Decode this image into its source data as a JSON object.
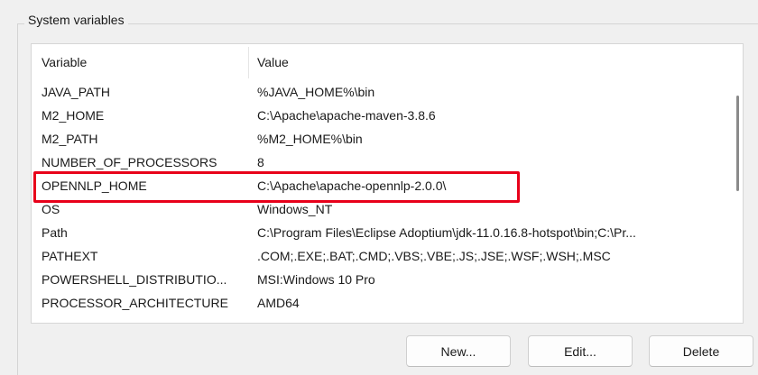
{
  "group": {
    "title": "System variables"
  },
  "list": {
    "columns": {
      "variable": "Variable",
      "value": "Value"
    },
    "rows": [
      {
        "variable": "JAVA_PATH",
        "value": "%JAVA_HOME%\\bin"
      },
      {
        "variable": "M2_HOME",
        "value": "C:\\Apache\\apache-maven-3.8.6"
      },
      {
        "variable": "M2_PATH",
        "value": "%M2_HOME%\\bin"
      },
      {
        "variable": "NUMBER_OF_PROCESSORS",
        "value": "8"
      },
      {
        "variable": "OPENNLP_HOME",
        "value": "C:\\Apache\\apache-opennlp-2.0.0\\"
      },
      {
        "variable": "OS",
        "value": "Windows_NT"
      },
      {
        "variable": "Path",
        "value": "C:\\Program Files\\Eclipse Adoptium\\jdk-11.0.16.8-hotspot\\bin;C:\\Pr..."
      },
      {
        "variable": "PATHEXT",
        "value": ".COM;.EXE;.BAT;.CMD;.VBS;.VBE;.JS;.JSE;.WSF;.WSH;.MSC"
      },
      {
        "variable": "POWERSHELL_DISTRIBUTIO...",
        "value": "MSI:Windows 10 Pro"
      },
      {
        "variable": "PROCESSOR_ARCHITECTURE",
        "value": "AMD64"
      }
    ]
  },
  "buttons": {
    "new": "New...",
    "edit": "Edit...",
    "delete": "Delete"
  },
  "colors": {
    "highlight": "#e8001a",
    "background": "#f0f0f0"
  }
}
